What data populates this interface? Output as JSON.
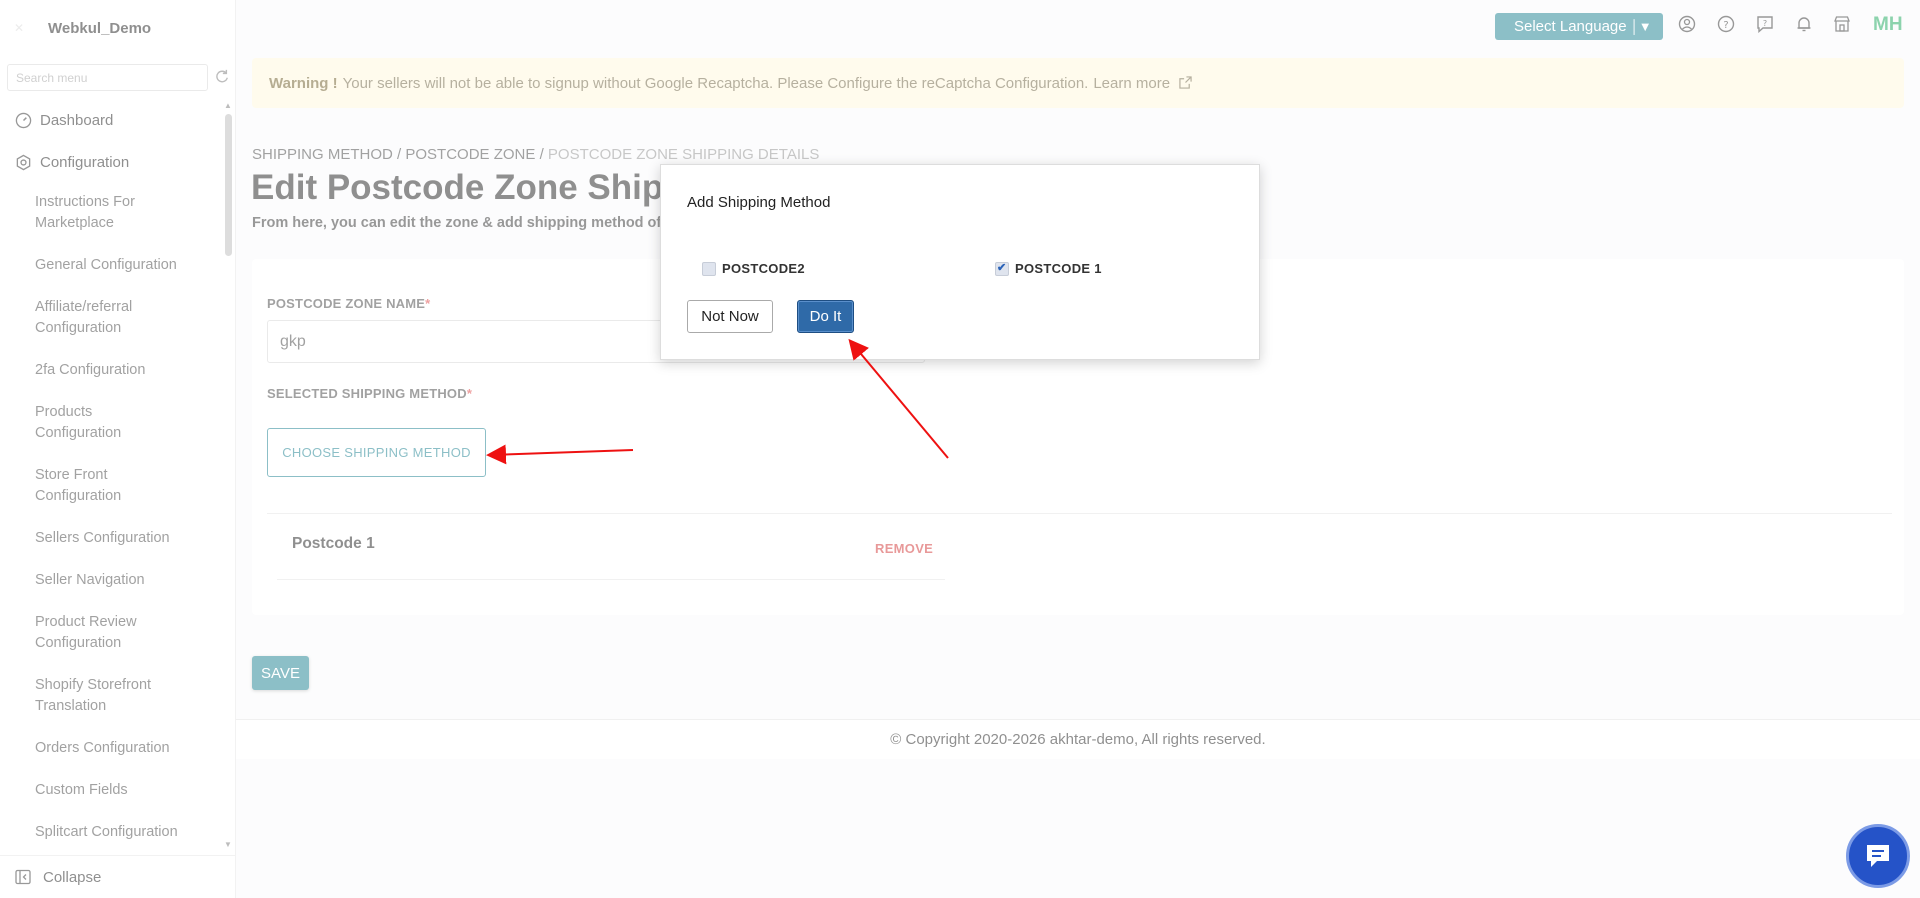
{
  "brand": {
    "name": "Webkul_Demo"
  },
  "search": {
    "placeholder": "Search menu"
  },
  "sidebar": {
    "items": [
      {
        "label": "Dashboard"
      },
      {
        "label": "Configuration"
      }
    ],
    "sub_items": [
      "Instructions For Marketplace",
      "General Configuration",
      "Affiliate/referral Configuration",
      "2fa Configuration",
      "Products Configuration",
      "Store Front Configuration",
      "Sellers Configuration",
      "Seller Navigation",
      "Product Review Configuration",
      "Shopify Storefront Translation",
      "Orders Configuration",
      "Custom Fields",
      "Splitcart Configuration"
    ],
    "collapse": "Collapse"
  },
  "topbar": {
    "language": "Select Language",
    "avatar_initials": "MH",
    "colors": {
      "accent": "#2e8b9a",
      "avatar": "#2faf6a"
    }
  },
  "warning": {
    "label": "Warning !",
    "text": "Your sellers will not be able to signup without Google Recaptcha. Please Configure the reCaptcha Configuration.",
    "link": "Learn more"
  },
  "breadcrumb": {
    "items": [
      "SHIPPING METHOD",
      "POSTCODE ZONE"
    ],
    "current": "POSTCODE ZONE SHIPPING DETAILS",
    "sep": "/"
  },
  "page": {
    "title": "Edit Postcode Zone Shippi",
    "subtitle": "From here, you can edit the zone & add shipping method of th"
  },
  "form": {
    "zone_name_label": "POSTCODE ZONE NAME",
    "zone_name_value": "gkp",
    "shipping_label": "SELECTED SHIPPING METHOD",
    "required_mark": "*",
    "choose_button": "CHOOSE SHIPPING METHOD",
    "selected_methods": [
      {
        "name": "Postcode 1",
        "action": "REMOVE"
      }
    ],
    "save": "SAVE"
  },
  "footer": {
    "text": "© Copyright 2020-2026 akhtar-demo, All rights reserved."
  },
  "modal": {
    "title": "Add Shipping Method",
    "options": [
      {
        "label": "POSTCODE2",
        "checked": false
      },
      {
        "label": "POSTCODE 1",
        "checked": true
      }
    ],
    "cancel": "Not Now",
    "confirm": "Do It"
  }
}
